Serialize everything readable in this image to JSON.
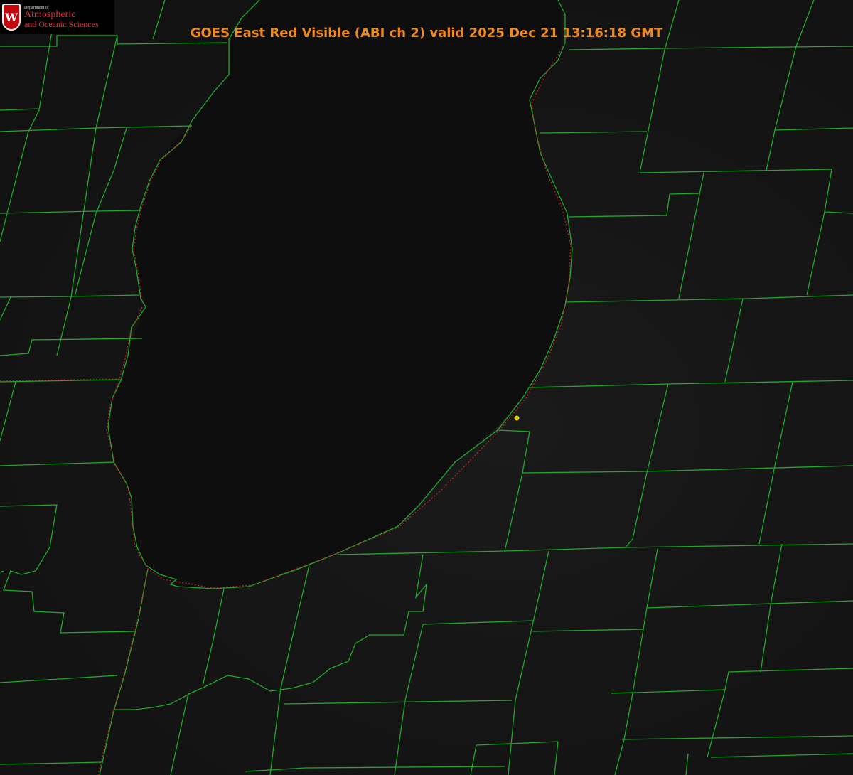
{
  "header": {
    "title": "GOES East Red Visible (ABI ch 2) valid 2025 Dec 21 13:16:18 GMT"
  },
  "logo": {
    "crest_letter": "W",
    "dept_line": "Department of",
    "line1": "Atmospheric",
    "line2": "and Oceanic Sciences"
  },
  "colors": {
    "background": "#141414",
    "boundaries": "#1fa82a",
    "state_line": "#c4262e",
    "title": "#f08a1e",
    "marker": "#e6d21e"
  }
}
